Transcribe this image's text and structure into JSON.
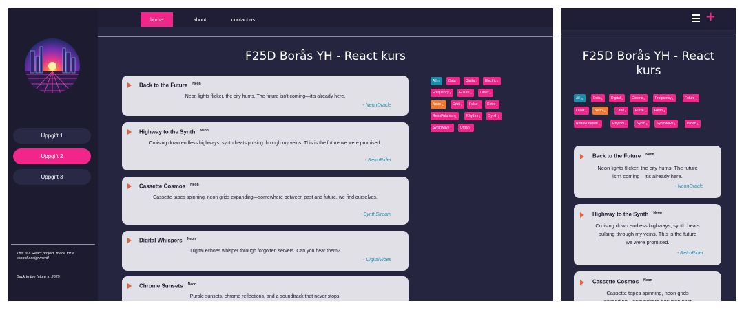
{
  "nav": {
    "home": "home",
    "about": "about",
    "contact": "contact us"
  },
  "sidebar": {
    "buttons": [
      {
        "label": "Uppgift 1",
        "active": false
      },
      {
        "label": "Uppgift 2",
        "active": true
      },
      {
        "label": "Uppgift 3",
        "active": false
      }
    ],
    "footer_line1": "This is a React project, made for a school assignment!",
    "footer_line2": "Back to the future in 2025"
  },
  "page_title": "F25D Borås YH - React kurs",
  "tags": [
    {
      "label": "All",
      "count": "20"
    },
    {
      "label": "Data",
      "count": "1"
    },
    {
      "label": "Digital",
      "count": "1"
    },
    {
      "label": "Electric",
      "count": "1"
    },
    {
      "label": "Frequency",
      "count": "1"
    },
    {
      "label": "Future",
      "count": "1"
    },
    {
      "label": "Laser",
      "count": "1"
    },
    {
      "label": "Neon",
      "count": "13"
    },
    {
      "label": "Orbit",
      "count": "1"
    },
    {
      "label": "Pulse",
      "count": "1"
    },
    {
      "label": "Retro",
      "count": "1"
    },
    {
      "label": "RetroFuturism",
      "count": "1"
    },
    {
      "label": "Rhythm",
      "count": "1"
    },
    {
      "label": "Synth",
      "count": "1"
    },
    {
      "label": "Synthwave",
      "count": "1"
    },
    {
      "label": "Urban",
      "count": "1"
    }
  ],
  "posts": [
    {
      "title": "Back to the Future",
      "tag": "Neon",
      "body": "Neon lights flicker, the city hums. The future isn't coming—it's already here.",
      "author": "- NeonOracle"
    },
    {
      "title": "Highway to the Synth",
      "tag": "Neon",
      "body": "Cruising down endless highways, synth beats pulsing through my veins. This is the future we were promised.",
      "author": "- RetroRider"
    },
    {
      "title": "Cassette Cosmos",
      "tag": "Neon",
      "body": "Cassette tapes spinning, neon grids expanding—somewhere between past and future, we find ourselves.",
      "author": "- SynthStream"
    },
    {
      "title": "Digital Whispers",
      "tag": "Neon",
      "body": "Digital echoes whisper through forgotten servers. Can you hear them?",
      "author": "- DigitalVibes"
    },
    {
      "title": "Chrome Sunsets",
      "tag": "Neon",
      "body": "Purple sunsets, chrome reflections, and a soundtrack that never stops.",
      "author": ""
    }
  ],
  "mobile": {
    "title": "F25D Borås YH - React kurs",
    "posts": [
      {
        "title": "Back to the Future",
        "tag": "Neon",
        "body": "Neon lights flicker, the city hums. The future isn't coming—it's already here.",
        "author": "- NeonOracle"
      },
      {
        "title": "Highway to the Synth",
        "tag": "Neon",
        "body": "Cruising down endless highways, synth beats pulsing through my veins. This is the future we were promised.",
        "author": "- RetroRider"
      },
      {
        "title": "Cassette Cosmos",
        "tag": "Neon",
        "body": "Cassette tapes spinning, neon grids expanding—somewhere between past",
        "author": ""
      }
    ]
  },
  "colors": {
    "accent": "#f0268a",
    "all_tag": "#1e8ca8",
    "neon_tag": "#f07830",
    "background": "#262540",
    "card": "#e1e0e6",
    "author": "#2a8db0"
  }
}
